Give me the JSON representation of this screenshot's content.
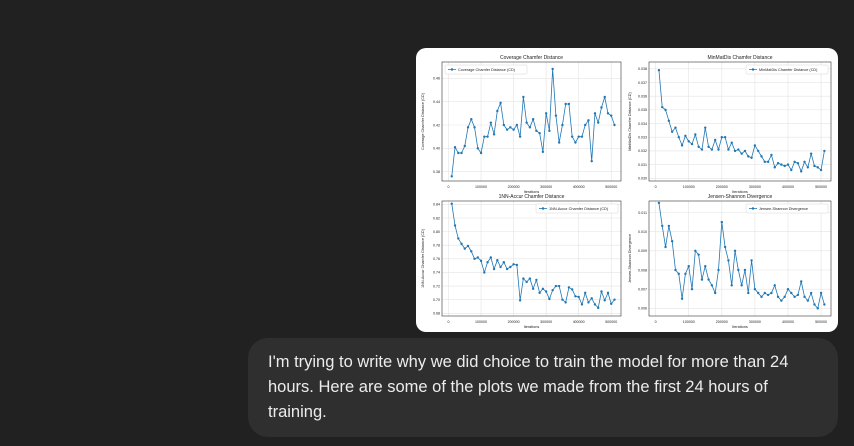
{
  "message": {
    "text": "I'm trying to write why we did choice to train the model for more than 24 hours. Here are some of the plots we made from the first 24 hours of training."
  },
  "colors": {
    "background": "#212121",
    "bubble": "#2f2f2f",
    "text": "#ececec",
    "series": "#1f77b4"
  },
  "chart_data": [
    {
      "type": "line",
      "title": "Coverage Chamfer Distance",
      "xlabel": "Iterations",
      "ylabel": "Coverage Chamfer Distance (CD)",
      "legend": "Coverage Chamfer Distance (CD)",
      "legend_position": "top-left",
      "grid": true,
      "xlim": [
        -20000,
        530000
      ],
      "ylim": [
        0.372,
        0.474
      ],
      "xticks": [
        0,
        100000,
        200000,
        300000,
        400000,
        500000
      ],
      "yticks": [
        0.38,
        0.4,
        0.42,
        0.44,
        0.46
      ],
      "ytick_labels": [
        "0.38",
        "0.40",
        "0.42",
        "0.44",
        "0.46"
      ],
      "x": [
        10000,
        20000,
        30000,
        40000,
        50000,
        60000,
        70000,
        80000,
        90000,
        100000,
        110000,
        120000,
        130000,
        140000,
        150000,
        160000,
        170000,
        180000,
        190000,
        200000,
        210000,
        220000,
        230000,
        240000,
        250000,
        260000,
        270000,
        280000,
        290000,
        300000,
        310000,
        320000,
        330000,
        340000,
        350000,
        360000,
        370000,
        380000,
        390000,
        400000,
        410000,
        420000,
        430000,
        440000,
        450000,
        460000,
        470000,
        480000,
        490000,
        500000,
        510000
      ],
      "y": [
        0.376,
        0.401,
        0.396,
        0.396,
        0.402,
        0.418,
        0.425,
        0.418,
        0.4,
        0.396,
        0.41,
        0.41,
        0.422,
        0.412,
        0.432,
        0.439,
        0.42,
        0.416,
        0.418,
        0.416,
        0.42,
        0.41,
        0.444,
        0.422,
        0.418,
        0.425,
        0.415,
        0.413,
        0.397,
        0.43,
        0.415,
        0.468,
        0.428,
        0.405,
        0.42,
        0.438,
        0.438,
        0.41,
        0.405,
        0.41,
        0.41,
        0.42,
        0.424,
        0.389,
        0.43,
        0.422,
        0.435,
        0.444,
        0.43,
        0.428,
        0.42
      ]
    },
    {
      "type": "line",
      "title": "MinMatDis Chamfer Distance",
      "xlabel": "Iterations",
      "ylabel": "MinMatDis Chamfer Distance (CD)",
      "legend": "MinMatDis Chamfer Distance (CD)",
      "legend_position": "top-right",
      "grid": true,
      "xlim": [
        -20000,
        530000
      ],
      "ylim": [
        0.0298,
        0.0385
      ],
      "xticks": [
        0,
        100000,
        200000,
        300000,
        400000,
        500000
      ],
      "yticks": [
        0.03,
        0.031,
        0.032,
        0.033,
        0.034,
        0.035,
        0.036,
        0.037,
        0.038
      ],
      "ytick_labels": [
        "0.030",
        "0.031",
        "0.032",
        "0.033",
        "0.034",
        "0.035",
        "0.036",
        "0.037",
        "0.038"
      ],
      "x": [
        10000,
        20000,
        30000,
        40000,
        50000,
        60000,
        70000,
        80000,
        90000,
        100000,
        110000,
        120000,
        130000,
        140000,
        150000,
        160000,
        170000,
        180000,
        190000,
        200000,
        210000,
        220000,
        230000,
        240000,
        250000,
        260000,
        270000,
        280000,
        290000,
        300000,
        310000,
        320000,
        330000,
        340000,
        350000,
        360000,
        370000,
        380000,
        390000,
        400000,
        410000,
        420000,
        430000,
        440000,
        450000,
        460000,
        470000,
        480000,
        490000,
        500000,
        510000
      ],
      "y": [
        0.0379,
        0.0352,
        0.035,
        0.0342,
        0.0334,
        0.0337,
        0.033,
        0.0324,
        0.0331,
        0.0327,
        0.0325,
        0.0332,
        0.0323,
        0.0321,
        0.0337,
        0.0323,
        0.0321,
        0.0328,
        0.0321,
        0.033,
        0.033,
        0.0321,
        0.0326,
        0.032,
        0.0321,
        0.0318,
        0.032,
        0.0316,
        0.0315,
        0.0324,
        0.032,
        0.0316,
        0.0312,
        0.0312,
        0.0317,
        0.0308,
        0.0311,
        0.031,
        0.0309,
        0.031,
        0.0306,
        0.0312,
        0.0311,
        0.0305,
        0.0312,
        0.0308,
        0.0318,
        0.0309,
        0.0308,
        0.0306,
        0.032
      ]
    },
    {
      "type": "line",
      "title": "1NN-Accur Chamfer Distance",
      "xlabel": "Iterations",
      "ylabel": "1NN-Accur Chamfer Distance (CD)",
      "legend": "1NN-Accur Chamfer Distance (CD)",
      "legend_position": "top-right",
      "grid": true,
      "xlim": [
        -20000,
        530000
      ],
      "ylim": [
        0.676,
        0.845
      ],
      "xticks": [
        0,
        100000,
        200000,
        300000,
        400000,
        500000
      ],
      "yticks": [
        0.68,
        0.7,
        0.72,
        0.74,
        0.76,
        0.78,
        0.8,
        0.82,
        0.84
      ],
      "ytick_labels": [
        "0.68",
        "0.70",
        "0.72",
        "0.74",
        "0.76",
        "0.78",
        "0.80",
        "0.82",
        "0.84"
      ],
      "x": [
        10000,
        20000,
        30000,
        40000,
        50000,
        60000,
        70000,
        80000,
        90000,
        100000,
        110000,
        120000,
        130000,
        140000,
        150000,
        160000,
        170000,
        180000,
        190000,
        200000,
        210000,
        220000,
        230000,
        240000,
        250000,
        260000,
        270000,
        280000,
        290000,
        300000,
        310000,
        320000,
        330000,
        340000,
        350000,
        360000,
        370000,
        380000,
        390000,
        400000,
        410000,
        420000,
        430000,
        440000,
        450000,
        460000,
        470000,
        480000,
        490000,
        500000,
        510000
      ],
      "y": [
        0.841,
        0.809,
        0.79,
        0.782,
        0.775,
        0.779,
        0.771,
        0.76,
        0.762,
        0.757,
        0.74,
        0.755,
        0.762,
        0.745,
        0.758,
        0.748,
        0.755,
        0.745,
        0.748,
        0.752,
        0.751,
        0.699,
        0.731,
        0.726,
        0.731,
        0.716,
        0.729,
        0.71,
        0.716,
        0.712,
        0.701,
        0.714,
        0.72,
        0.72,
        0.7,
        0.696,
        0.718,
        0.715,
        0.705,
        0.704,
        0.693,
        0.71,
        0.696,
        0.702,
        0.693,
        0.688,
        0.712,
        0.699,
        0.71,
        0.694,
        0.7
      ]
    },
    {
      "type": "line",
      "title": "Jensen-Shannon Divergence",
      "xlabel": "Iterations",
      "ylabel": "Jensen-Shannon Divergence",
      "legend": "Jensen-Shannon Divergence",
      "legend_position": "top-right",
      "grid": true,
      "xlim": [
        -20000,
        530000
      ],
      "ylim": [
        0.0056,
        0.0116
      ],
      "xticks": [
        0,
        100000,
        200000,
        300000,
        400000,
        500000
      ],
      "yticks": [
        0.006,
        0.007,
        0.008,
        0.009,
        0.01,
        0.011
      ],
      "ytick_labels": [
        "0.006",
        "0.007",
        "0.008",
        "0.009",
        "0.010",
        "0.011"
      ],
      "x": [
        10000,
        20000,
        30000,
        40000,
        50000,
        60000,
        70000,
        80000,
        90000,
        100000,
        110000,
        120000,
        130000,
        140000,
        150000,
        160000,
        170000,
        180000,
        190000,
        200000,
        210000,
        220000,
        230000,
        240000,
        250000,
        260000,
        270000,
        280000,
        290000,
        300000,
        310000,
        320000,
        330000,
        340000,
        350000,
        360000,
        370000,
        380000,
        390000,
        400000,
        410000,
        420000,
        430000,
        440000,
        450000,
        460000,
        470000,
        480000,
        490000,
        500000,
        510000
      ],
      "y": [
        0.0115,
        0.0103,
        0.0092,
        0.0103,
        0.0095,
        0.008,
        0.0078,
        0.0065,
        0.0078,
        0.0082,
        0.007,
        0.009,
        0.0088,
        0.0075,
        0.0082,
        0.0075,
        0.0072,
        0.0068,
        0.008,
        0.0105,
        0.0092,
        0.0085,
        0.0072,
        0.009,
        0.008,
        0.0072,
        0.008,
        0.0068,
        0.0085,
        0.007,
        0.0068,
        0.0066,
        0.0068,
        0.0067,
        0.0068,
        0.0072,
        0.0066,
        0.0064,
        0.0066,
        0.007,
        0.0068,
        0.0066,
        0.0067,
        0.0074,
        0.0066,
        0.0064,
        0.0068,
        0.0062,
        0.006,
        0.0068,
        0.0062
      ]
    }
  ]
}
